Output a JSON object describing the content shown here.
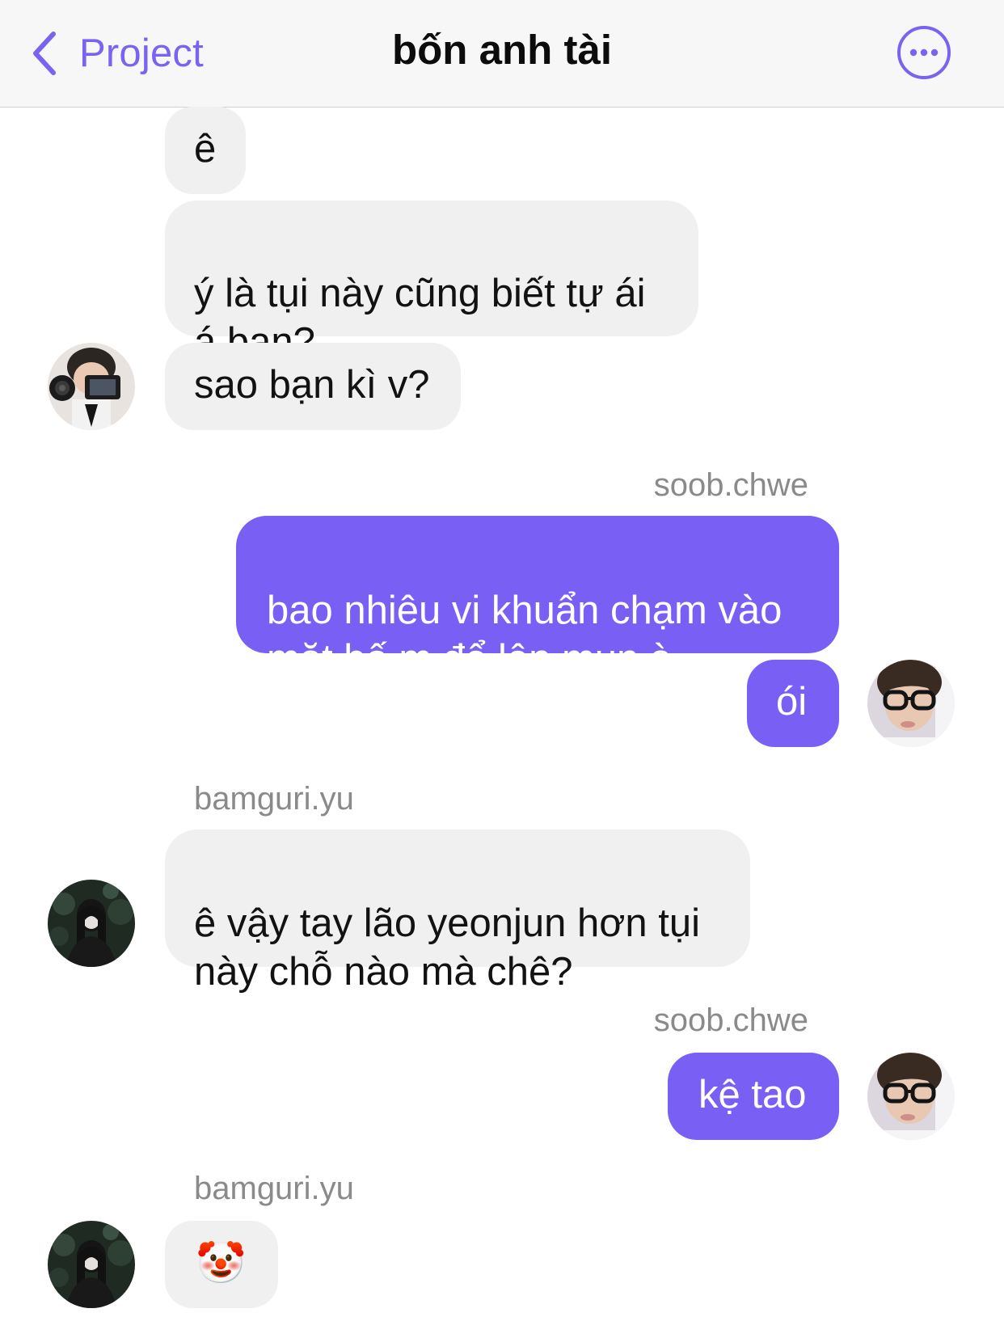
{
  "header": {
    "back_label": "Project",
    "title": "bốn anh tài"
  },
  "colors": {
    "accent": "#7a63f0",
    "outgoing_bubble": "#7a5ff5",
    "incoming_bubble": "#f0f0f0"
  },
  "messages": [
    {
      "sender": "",
      "direction": "in",
      "text": "ê"
    },
    {
      "sender": "",
      "direction": "in",
      "text": "ý là tụi này cũng biết tự ái\ná bạn?"
    },
    {
      "sender": "",
      "direction": "in",
      "text": "sao bạn kì v?"
    },
    {
      "sender": "soob.chwe",
      "direction": "out",
      "text": "bao nhiêu vi khuẩn chạm vào\nmặt bố m để lên mụn à"
    },
    {
      "sender": "",
      "direction": "out",
      "text": "ói"
    },
    {
      "sender": "bamguri.yu",
      "direction": "in",
      "text": "ê vậy tay lão yeonjun hơn tụi\nnày chỗ nào mà chê?"
    },
    {
      "sender": "soob.chwe",
      "direction": "out",
      "text": "kệ tao"
    },
    {
      "sender": "bamguri.yu",
      "direction": "in",
      "text": "🤡",
      "icon": "clown-face-emoji"
    }
  ]
}
